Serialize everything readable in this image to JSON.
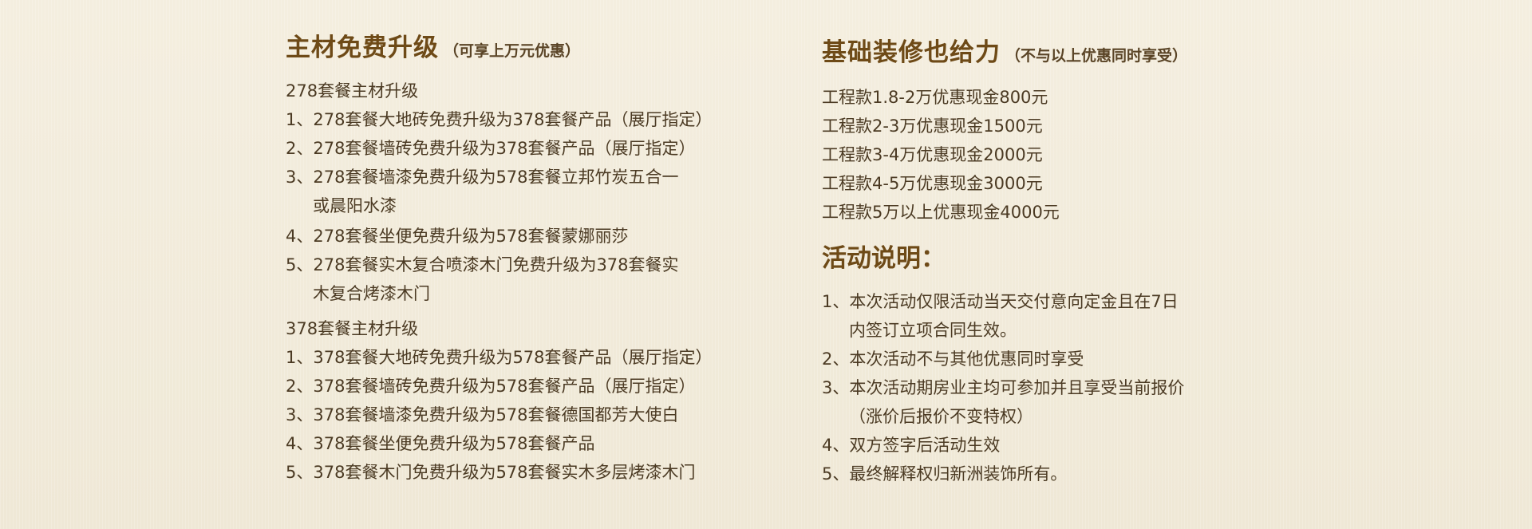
{
  "left": {
    "title": "主材免费升级",
    "subtitle": "（可享上万元优惠）",
    "group1": {
      "heading": "278套餐主材升级",
      "items": [
        "1、278套餐大地砖免费升级为378套餐产品（展厅指定）",
        "2、278套餐墙砖免费升级为378套餐产品（展厅指定）",
        "3、278套餐墙漆免费升级为578套餐立邦竹炭五合一",
        "或晨阳水漆",
        "4、278套餐坐便免费升级为578套餐蒙娜丽莎",
        "5、278套餐实木复合喷漆木门免费升级为378套餐实",
        "木复合烤漆木门"
      ]
    },
    "group2": {
      "heading": "378套餐主材升级",
      "items": [
        "1、378套餐大地砖免费升级为578套餐产品（展厅指定）",
        "2、378套餐墙砖免费升级为578套餐产品（展厅指定）",
        "3、378套餐墙漆免费升级为578套餐德国都芳大使白",
        "4、378套餐坐便免费升级为578套餐产品",
        "5、378套餐木门免费升级为578套餐实木多层烤漆木门"
      ]
    }
  },
  "right": {
    "title": "基础装修也给力",
    "subtitle": "（不与以上优惠同时享受）",
    "discounts": [
      "工程款1.8-2万优惠现金800元",
      "工程款2-3万优惠现金1500元",
      "工程款3-4万优惠现金2000元",
      "工程款4-5万优惠现金3000元",
      "工程款5万以上优惠现金4000元"
    ],
    "notes_title": "活动说明：",
    "notes": [
      "1、本次活动仅限活动当天交付意向定金且在7日",
      "内签订立项合同生效。",
      "2、本次活动不与其他优惠同时享受",
      "3、本次活动期房业主均可参加并且享受当前报价",
      "（涨价后报价不变特权）",
      "4、双方签字后活动生效",
      "5、最终解释权归新洲装饰所有。"
    ]
  }
}
